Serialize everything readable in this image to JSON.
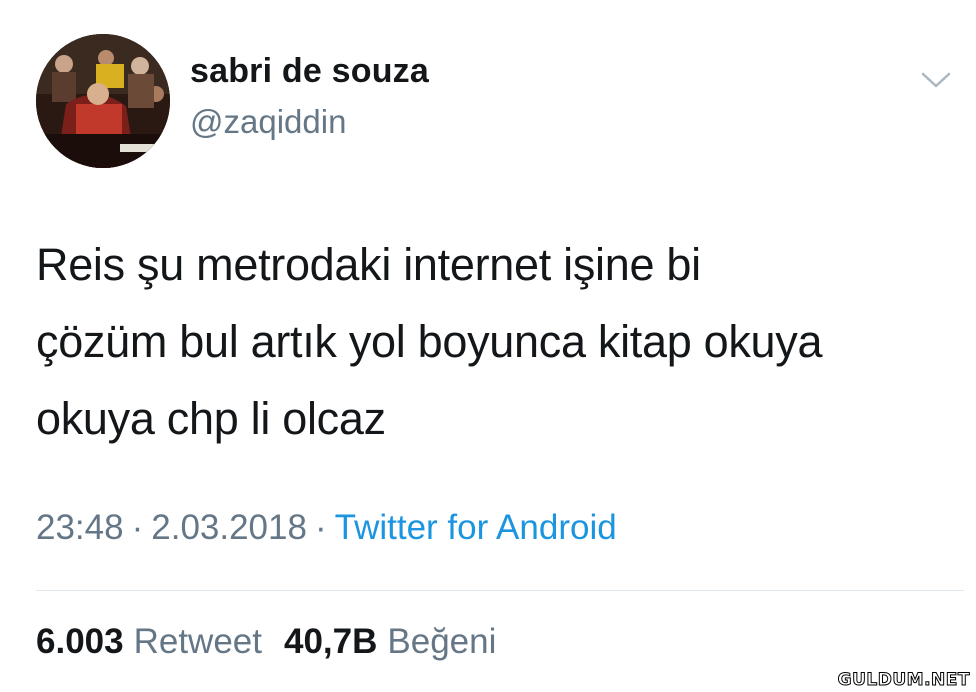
{
  "user": {
    "display_name": "sabri de souza",
    "handle": "@zaqiddin",
    "avatar_icon": "profile-photo"
  },
  "menu_icon": "chevron-down-icon",
  "tweet": {
    "lines": [
      "Reis şu metrodaki internet işine bi",
      "çözüm bul artık yol boyunca kitap okuya",
      "okuya chp li olcaz"
    ],
    "time": "23:48",
    "date": "2.03.2018",
    "separator": "·",
    "source": "Twitter for Android"
  },
  "stats": {
    "retweet_count": "6.003",
    "retweet_label": "Retweet",
    "like_count": "40,7B",
    "like_label": "Beğeni"
  },
  "watermark": "GULDUM.NET",
  "colors": {
    "text_primary": "#14171a",
    "text_secondary": "#657786",
    "link": "#1b95e0",
    "divider": "#e1e8ed"
  }
}
